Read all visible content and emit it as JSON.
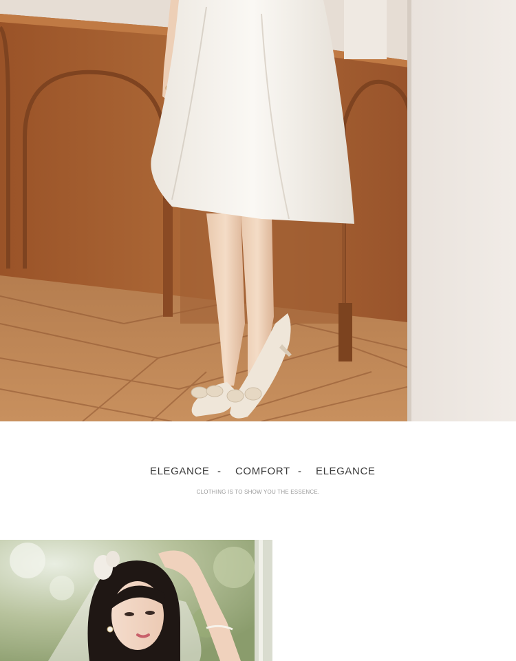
{
  "photos": {
    "top": {
      "subject": "white midi dress with bow-front pointed heels on herringbone wood floor"
    },
    "bottom": {
      "subject": "bride with dark hair, white bow and veil, pearl earrings"
    }
  },
  "tagline": {
    "word_1": "ELEGANCE",
    "separator_1": "-",
    "word_2": "COMFORT",
    "separator_2": "-",
    "word_3": "ELEGANCE",
    "subline": "CLOTHING IS TO SHOW YOU THE ESSENCE."
  },
  "colors": {
    "text": "#3a3a3a",
    "subtext": "#9a9a9a",
    "wood": "#a45f2f",
    "dress": "#f3efe8",
    "background": "#ffffff"
  }
}
